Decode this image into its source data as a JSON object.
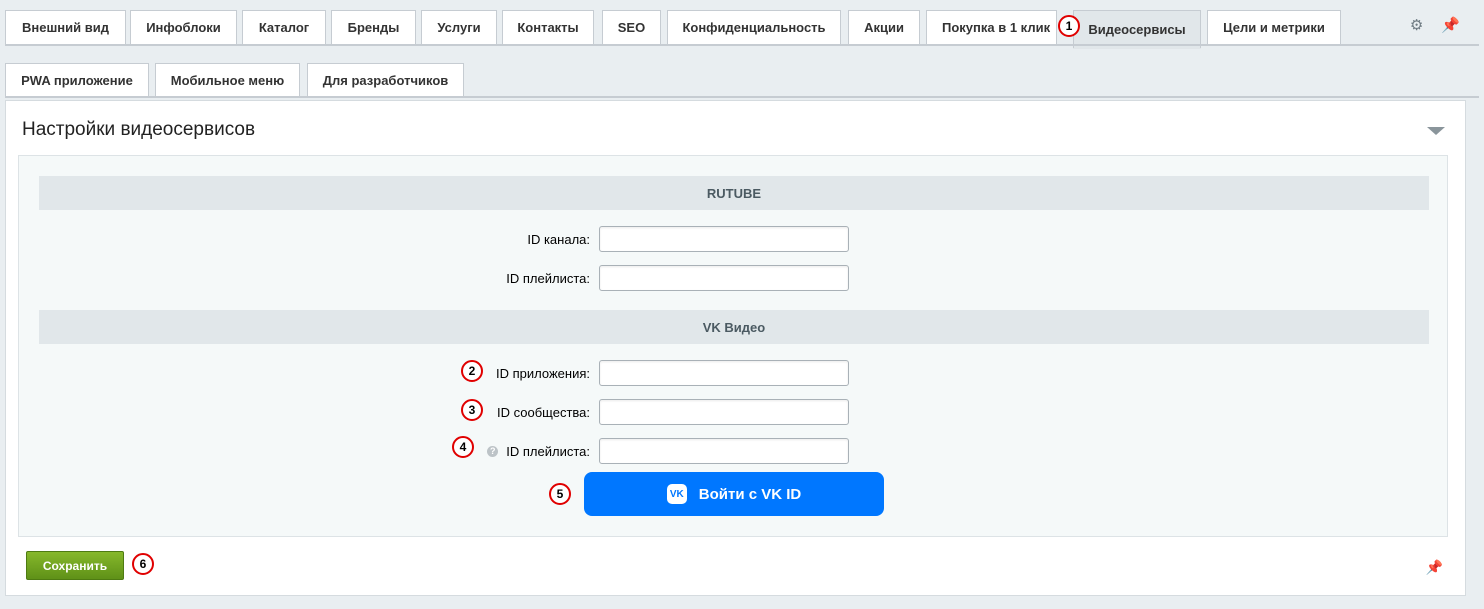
{
  "tabs_row1": [
    {
      "label": "Внешний вид",
      "active": false
    },
    {
      "label": "Инфоблоки",
      "active": false
    },
    {
      "label": "Каталог",
      "active": false
    },
    {
      "label": "Бренды",
      "active": false
    },
    {
      "label": "Услуги",
      "active": false
    },
    {
      "label": "Контакты",
      "active": false
    },
    {
      "label": "SEO",
      "active": false
    },
    {
      "label": "Конфиденциальность",
      "active": false
    },
    {
      "label": "Акции",
      "active": false
    },
    {
      "label": "Покупка в 1 клик",
      "active": false
    },
    {
      "label": "Видеосервисы",
      "active": true
    },
    {
      "label": "Цели и метрики",
      "active": false
    }
  ],
  "tabs_row2": [
    {
      "label": "PWA приложение",
      "active": false
    },
    {
      "label": "Мобильное меню",
      "active": false
    },
    {
      "label": "Для разработчиков",
      "active": false
    }
  ],
  "toolbar": {
    "settings_icon": "gear-icon",
    "pin_icon": "pin-icon"
  },
  "panel": {
    "title": "Настройки видеосервисов",
    "sections": {
      "rutube": {
        "heading": "RUTUBE",
        "fields": [
          {
            "label": "ID канала:",
            "value": ""
          },
          {
            "label": "ID плейлиста:",
            "value": ""
          }
        ]
      },
      "vk": {
        "heading": "VK Видео",
        "fields": [
          {
            "label": "ID приложения:",
            "value": ""
          },
          {
            "label": "ID сообщества:",
            "value": ""
          },
          {
            "label": "ID плейлиста:",
            "value": "",
            "help": "?"
          }
        ],
        "button_label": "Войти с VK ID",
        "button_logo": "VK"
      }
    }
  },
  "footer": {
    "save_label": "Сохранить"
  },
  "annotations": [
    "1",
    "2",
    "3",
    "4",
    "5",
    "6"
  ],
  "colors": {
    "accent": "#0077ff",
    "save": "#6fa11f",
    "badge": "#e00000"
  }
}
